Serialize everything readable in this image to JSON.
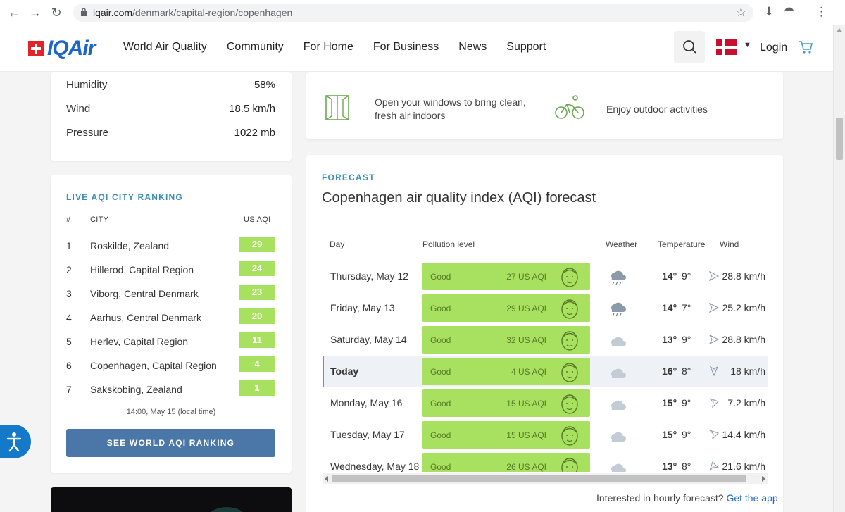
{
  "browser": {
    "url_host": "iqair.com",
    "url_path": "/denmark/capital-region/copenhagen"
  },
  "header": {
    "logo_text": "IQAir",
    "menu": [
      "World Air Quality",
      "Community",
      "For Home",
      "For Business",
      "News",
      "Support"
    ],
    "login_label": "Login"
  },
  "weather": {
    "rows": [
      {
        "label": "Humidity",
        "value": "58%"
      },
      {
        "label": "Wind",
        "value": "18.5 km/h"
      },
      {
        "label": "Pressure",
        "value": "1022 mb"
      }
    ]
  },
  "ranking": {
    "title": "LIVE AQI CITY RANKING",
    "col_num": "#",
    "col_city": "CITY",
    "col_aqi": "US AQI",
    "rows": [
      {
        "n": "1",
        "city": "Roskilde, Zealand",
        "aqi": "29"
      },
      {
        "n": "2",
        "city": "Hillerod, Capital Region",
        "aqi": "24"
      },
      {
        "n": "3",
        "city": "Viborg, Central Denmark",
        "aqi": "23"
      },
      {
        "n": "4",
        "city": "Aarhus, Central Denmark",
        "aqi": "20"
      },
      {
        "n": "5",
        "city": "Herlev, Capital Region",
        "aqi": "11"
      },
      {
        "n": "6",
        "city": "Copenhagen, Capital Region",
        "aqi": "4"
      },
      {
        "n": "7",
        "city": "Sakskobing, Zealand",
        "aqi": "1"
      }
    ],
    "timestamp": "14:00, May 15 (local time)",
    "button_label": "SEE WORLD AQI RANKING"
  },
  "recommendations": {
    "windows": [
      "Open your windows to bring clean,",
      "fresh air indoors"
    ],
    "outdoor": "Enjoy outdoor activities"
  },
  "forecast": {
    "label": "FORECAST",
    "title": "Copenhagen air quality index (AQI) forecast",
    "columns": {
      "day": "Day",
      "pollution": "Pollution level",
      "weather": "Weather",
      "temperature": "Temperature",
      "wind": "Wind"
    },
    "rows": [
      {
        "day": "Thursday, May 12",
        "level": "Good",
        "aqi": "27 US AQI",
        "weather_icon": "rain-cloud-icon",
        "hi": "14°",
        "lo": "9°",
        "wind": "28.8 km/h"
      },
      {
        "day": "Friday, May 13",
        "level": "Good",
        "aqi": "29 US AQI",
        "weather_icon": "rain-cloud-icon",
        "hi": "14°",
        "lo": "7°",
        "wind": "25.2 km/h"
      },
      {
        "day": "Saturday, May 14",
        "level": "Good",
        "aqi": "32 US AQI",
        "weather_icon": "cloud-icon",
        "hi": "13°",
        "lo": "9°",
        "wind": "28.8 km/h"
      },
      {
        "day": "Today",
        "level": "Good",
        "aqi": "4 US AQI",
        "weather_icon": "cloud-icon",
        "hi": "16°",
        "lo": "8°",
        "wind": "18 km/h"
      },
      {
        "day": "Monday, May 16",
        "level": "Good",
        "aqi": "15 US AQI",
        "weather_icon": "cloud-icon",
        "hi": "15°",
        "lo": "9°",
        "wind": "7.2 km/h"
      },
      {
        "day": "Tuesday, May 17",
        "level": "Good",
        "aqi": "15 US AQI",
        "weather_icon": "cloud-icon",
        "hi": "15°",
        "lo": "9°",
        "wind": "14.4 km/h"
      },
      {
        "day": "Wednesday, May 18",
        "level": "Good",
        "aqi": "26 US AQI",
        "weather_icon": "cloud-icon",
        "hi": "13°",
        "lo": "8°",
        "wind": "21.6 km/h"
      }
    ],
    "hourly_prompt": "Interested in hourly forecast?",
    "hourly_link": "Get the app"
  },
  "colors": {
    "good": "#a8e05f",
    "accent": "#3a8fb5",
    "button": "#4a76a8",
    "brand": "#1c66c9"
  }
}
